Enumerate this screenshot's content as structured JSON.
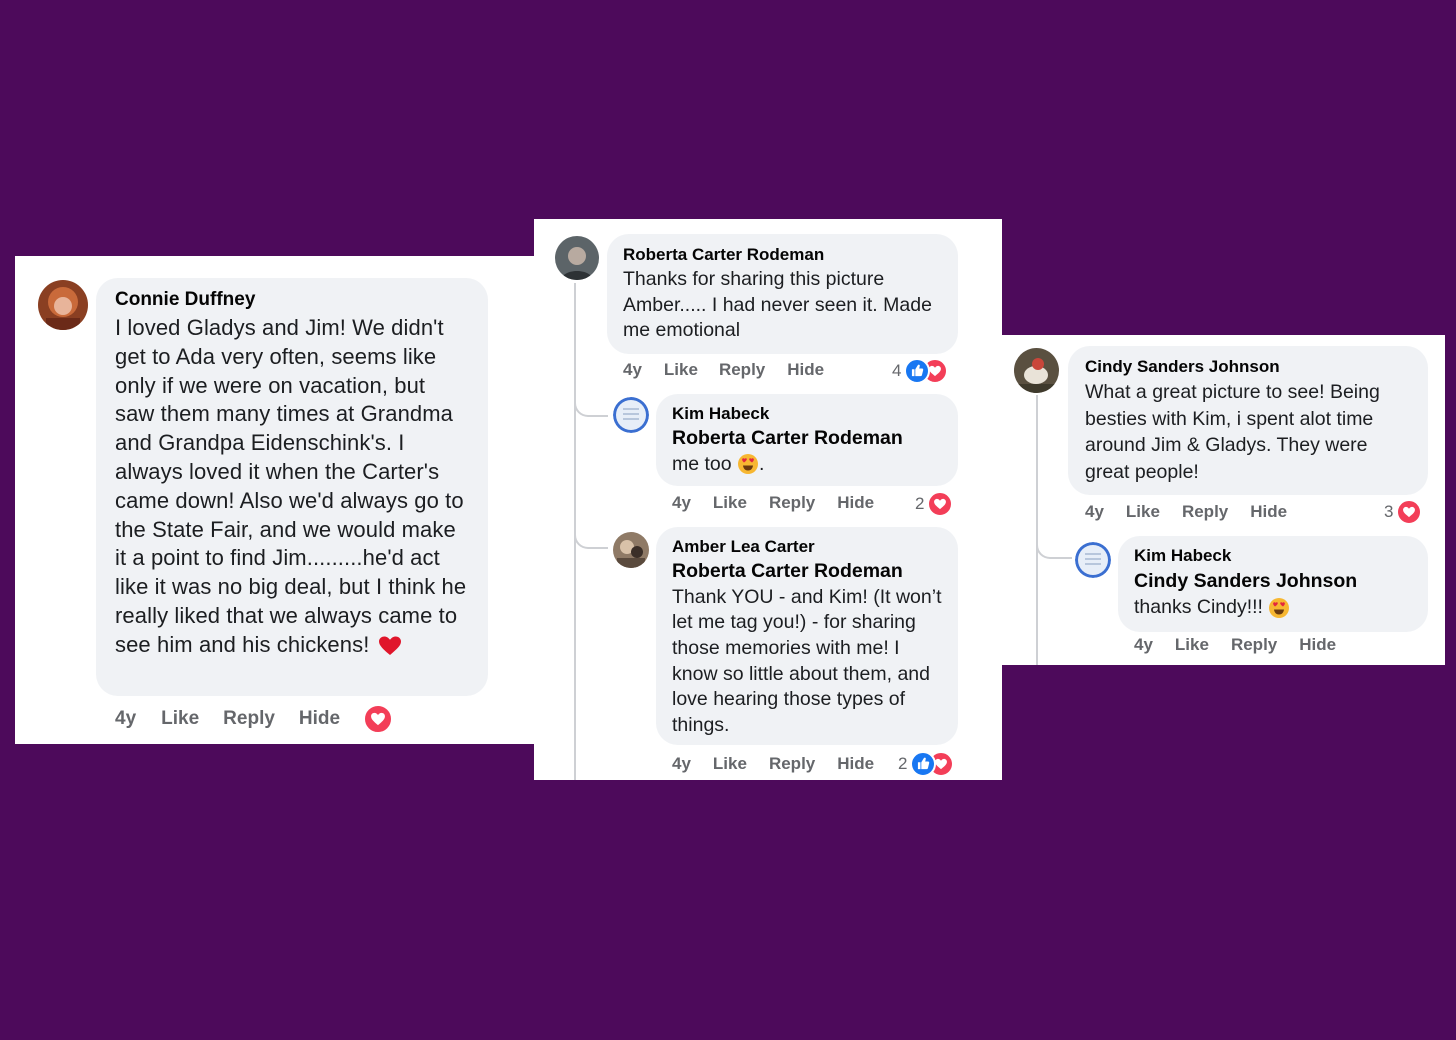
{
  "colors": {
    "background": "#4d0a5b",
    "bubble": "#f0f2f5",
    "action_text": "#65676b",
    "like_blue": "#1877f2",
    "love_red": "#f33e58"
  },
  "panels": [
    {
      "comment": {
        "author": "Connie Duffney",
        "text": "I loved Gladys and Jim! We didn't get to Ada very often, seems like only if we were on vacation, but saw them many times at Grandma and Grandpa Eidenschink's. I always loved it when the Carter's came down! Also we'd always go to the State Fair, and we would make it a point to find Jim.........he'd act like it was no big deal, but I think he really liked that we always came to see him and his chickens!",
        "emoji": "red-heart-emoji",
        "time": "4y",
        "like": "Like",
        "reply": "Reply",
        "hide": "Hide",
        "reaction_count": "",
        "reactions": [
          "love-icon"
        ]
      }
    },
    {
      "comment": {
        "author": "Roberta Carter Rodeman",
        "text": "Thanks for sharing this picture Amber..... I had never seen it. Made me emotional",
        "time": "4y",
        "like": "Like",
        "reply": "Reply",
        "hide": "Hide",
        "reaction_count": "4",
        "reactions": [
          "like-icon",
          "love-icon"
        ]
      },
      "replies": [
        {
          "author": "Kim Habeck",
          "tag": "Roberta Carter Rodeman",
          "text": "me too",
          "suffix": ".",
          "emoji": "heart-eyes-emoji",
          "time": "4y",
          "like": "Like",
          "reply": "Reply",
          "hide": "Hide",
          "reaction_count": "2",
          "reactions": [
            "love-icon"
          ]
        },
        {
          "author": "Amber Lea Carter",
          "tag": "Roberta Carter Rodeman",
          "text": "Thank YOU - and Kim! (It won’t let me tag you!) - for sharing those memories with me! I know so little about them, and love hearing those types of things.",
          "time": "4y",
          "like": "Like",
          "reply": "Reply",
          "hide": "Hide",
          "reaction_count": "2",
          "reactions": [
            "like-icon",
            "love-icon"
          ]
        }
      ]
    },
    {
      "comment": {
        "author": "Cindy Sanders Johnson",
        "text": "What a great picture to see! Being besties with Kim, i spent alot time around Jim & Gladys. They were great people!",
        "time": "4y",
        "like": "Like",
        "reply": "Reply",
        "hide": "Hide",
        "reaction_count": "3",
        "reactions": [
          "love-icon"
        ]
      },
      "replies": [
        {
          "author": "Kim Habeck",
          "tag": "Cindy Sanders Johnson",
          "text": "thanks Cindy!!!",
          "emoji": "heart-eyes-emoji",
          "time": "4y",
          "like": "Like",
          "reply": "Reply",
          "hide": "Hide"
        }
      ]
    }
  ]
}
